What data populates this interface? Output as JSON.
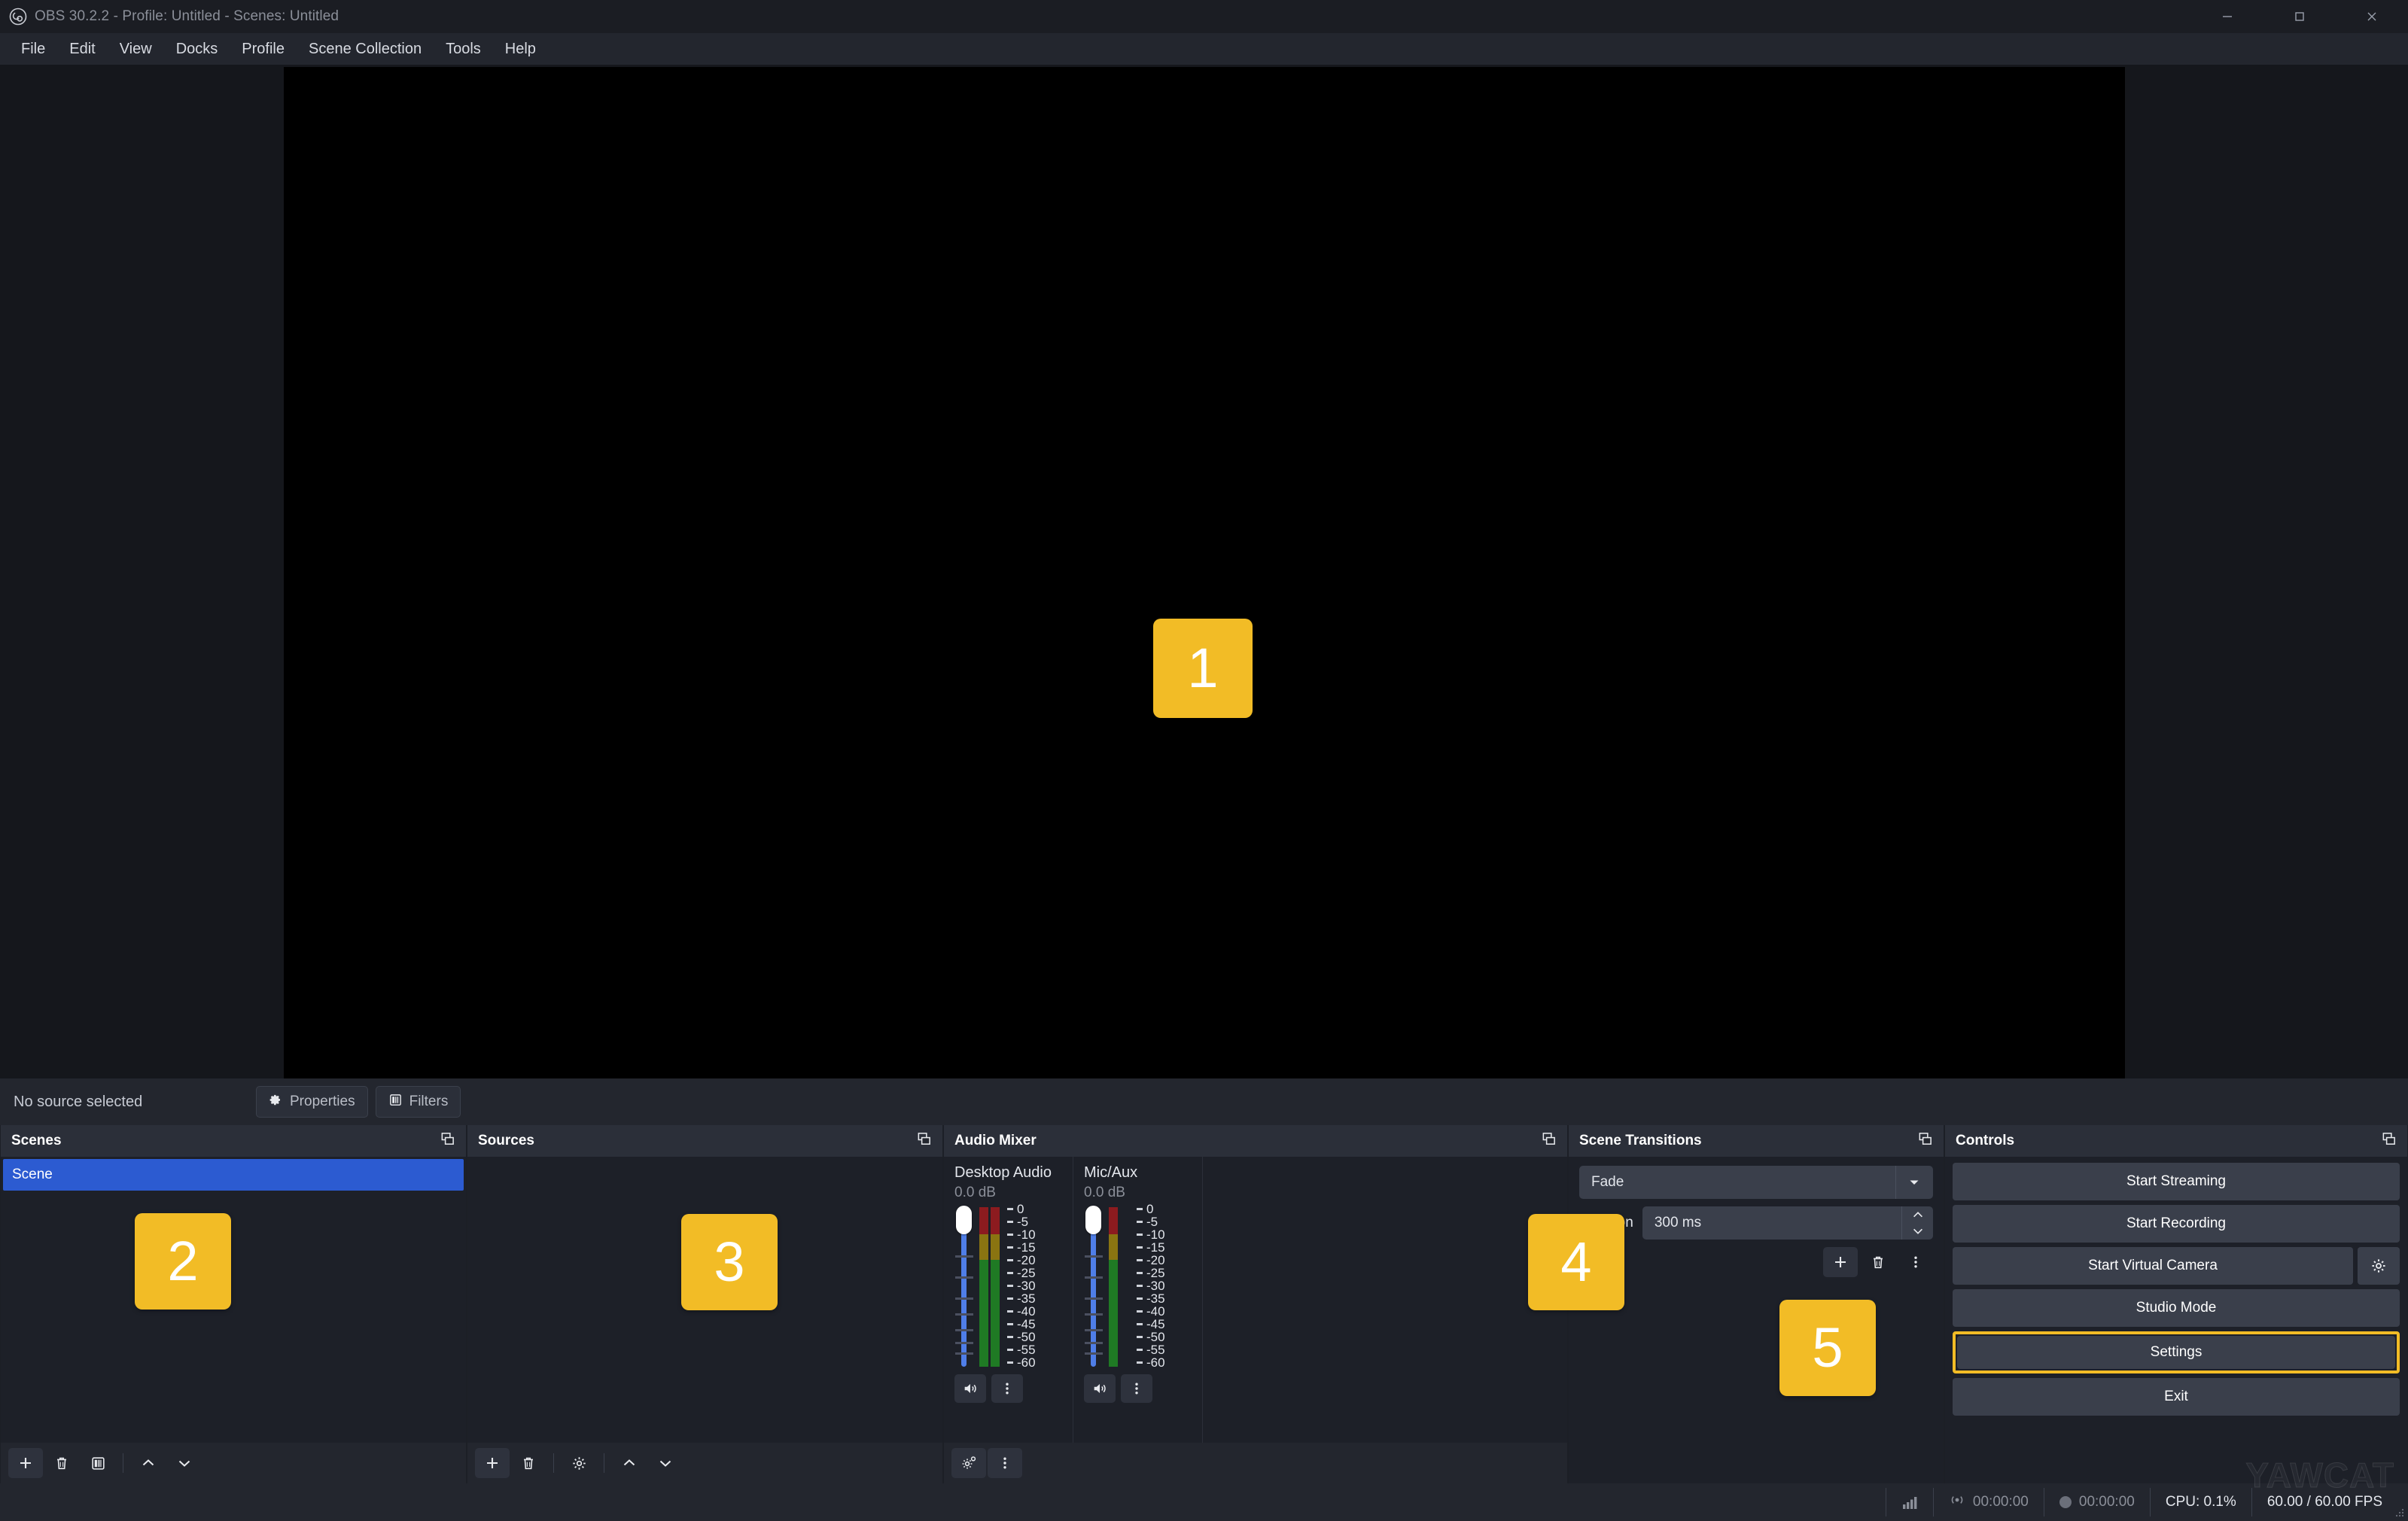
{
  "window": {
    "title": "OBS 30.2.2 - Profile: Untitled - Scenes: Untitled",
    "logo_icon": "obs-logo-icon",
    "minimize_icon": "minimize-icon",
    "maximize_icon": "maximize-icon",
    "close_icon": "close-icon"
  },
  "menubar": {
    "items": [
      {
        "label": "File"
      },
      {
        "label": "Edit"
      },
      {
        "label": "View"
      },
      {
        "label": "Docks"
      },
      {
        "label": "Profile"
      },
      {
        "label": "Scene Collection"
      },
      {
        "label": "Tools"
      },
      {
        "label": "Help"
      }
    ]
  },
  "annotations": {
    "preview": "1",
    "scenes": "2",
    "sources": "3",
    "audio_mixer": "4",
    "scene_transitions": "5",
    "color": "#f2bc26"
  },
  "source_strip": {
    "status": "No source selected",
    "properties_label": "Properties",
    "properties_icon": "gear-icon",
    "filters_label": "Filters",
    "filters_icon": "filters-icon"
  },
  "scenes": {
    "title": "Scenes",
    "popout_icon": "popout-icon",
    "items": [
      {
        "name": "Scene",
        "selected": true
      }
    ],
    "selected_color": "#2c5bd1",
    "toolbar": [
      {
        "name": "add-scene-button",
        "icon": "plus-icon"
      },
      {
        "name": "remove-scene-button",
        "icon": "trash-icon"
      },
      {
        "name": "scene-filters-button",
        "icon": "filters-icon"
      },
      {
        "name": "move-scene-up-button",
        "icon": "chevron-up-icon"
      },
      {
        "name": "move-scene-down-button",
        "icon": "chevron-down-icon"
      }
    ]
  },
  "sources": {
    "title": "Sources",
    "popout_icon": "popout-icon",
    "items": [],
    "toolbar": [
      {
        "name": "add-source-button",
        "icon": "plus-icon"
      },
      {
        "name": "remove-source-button",
        "icon": "trash-icon"
      },
      {
        "name": "source-properties-button",
        "icon": "gear-icon"
      },
      {
        "name": "move-source-up-button",
        "icon": "chevron-up-icon"
      },
      {
        "name": "move-source-down-button",
        "icon": "chevron-down-icon"
      }
    ]
  },
  "audio_mixer": {
    "title": "Audio Mixer",
    "popout_icon": "popout-icon",
    "channels": [
      {
        "name": "Desktop Audio",
        "volume_db": "0.0 dB",
        "mute_icon": "speaker-icon",
        "menu_icon": "kebab-menu-icon",
        "fader_position_pct": 100
      },
      {
        "name": "Mic/Aux",
        "volume_db": "0.0 dB",
        "mute_icon": "speaker-icon",
        "menu_icon": "kebab-menu-icon",
        "fader_position_pct": 100
      }
    ],
    "meter_scale": [
      "0",
      "-5",
      "-10",
      "-15",
      "-20",
      "-25",
      "-30",
      "-35",
      "-40",
      "-45",
      "-50",
      "-55",
      "-60"
    ],
    "meter_colors": {
      "peak": "#8c1b1f",
      "warn": "#8a7411",
      "nominal": "#1f7a24"
    },
    "toolbar": [
      {
        "name": "advanced-audio-properties-button",
        "icon": "gear-advanced-icon"
      },
      {
        "name": "audio-mixer-menu-button",
        "icon": "kebab-menu-icon"
      }
    ]
  },
  "scene_transitions": {
    "title": "Scene Transitions",
    "popout_icon": "popout-icon",
    "transition": "Fade",
    "transition_options": [
      "Fade"
    ],
    "dropdown_icon": "chevron-down-icon",
    "duration_label": "Duration",
    "duration_value": "300 ms",
    "spin_up_icon": "chevron-up-icon",
    "spin_down_icon": "chevron-down-icon",
    "toolbar": [
      {
        "name": "add-transition-button",
        "icon": "plus-icon"
      },
      {
        "name": "remove-transition-button",
        "icon": "trash-icon"
      },
      {
        "name": "transition-menu-button",
        "icon": "kebab-menu-icon"
      }
    ]
  },
  "controls": {
    "title": "Controls",
    "popout_icon": "popout-icon",
    "start_streaming": "Start Streaming",
    "start_recording": "Start Recording",
    "start_virtual_camera": "Start Virtual Camera",
    "virtual_camera_settings_icon": "gear-icon",
    "studio_mode": "Studio Mode",
    "settings": "Settings",
    "exit": "Exit",
    "highlight_color": "#f2bc26"
  },
  "statusbar": {
    "signal_icon": "signal-bars-icon",
    "stream_icon": "broadcast-icon",
    "stream_time": "00:00:00",
    "record_icon": "record-dot-icon",
    "record_time": "00:00:00",
    "cpu": "CPU: 0.1%",
    "fps": "60.00 / 60.00 FPS",
    "grip_icon": "resize-grip-icon"
  },
  "watermark": {
    "text": "YAWCAT"
  }
}
